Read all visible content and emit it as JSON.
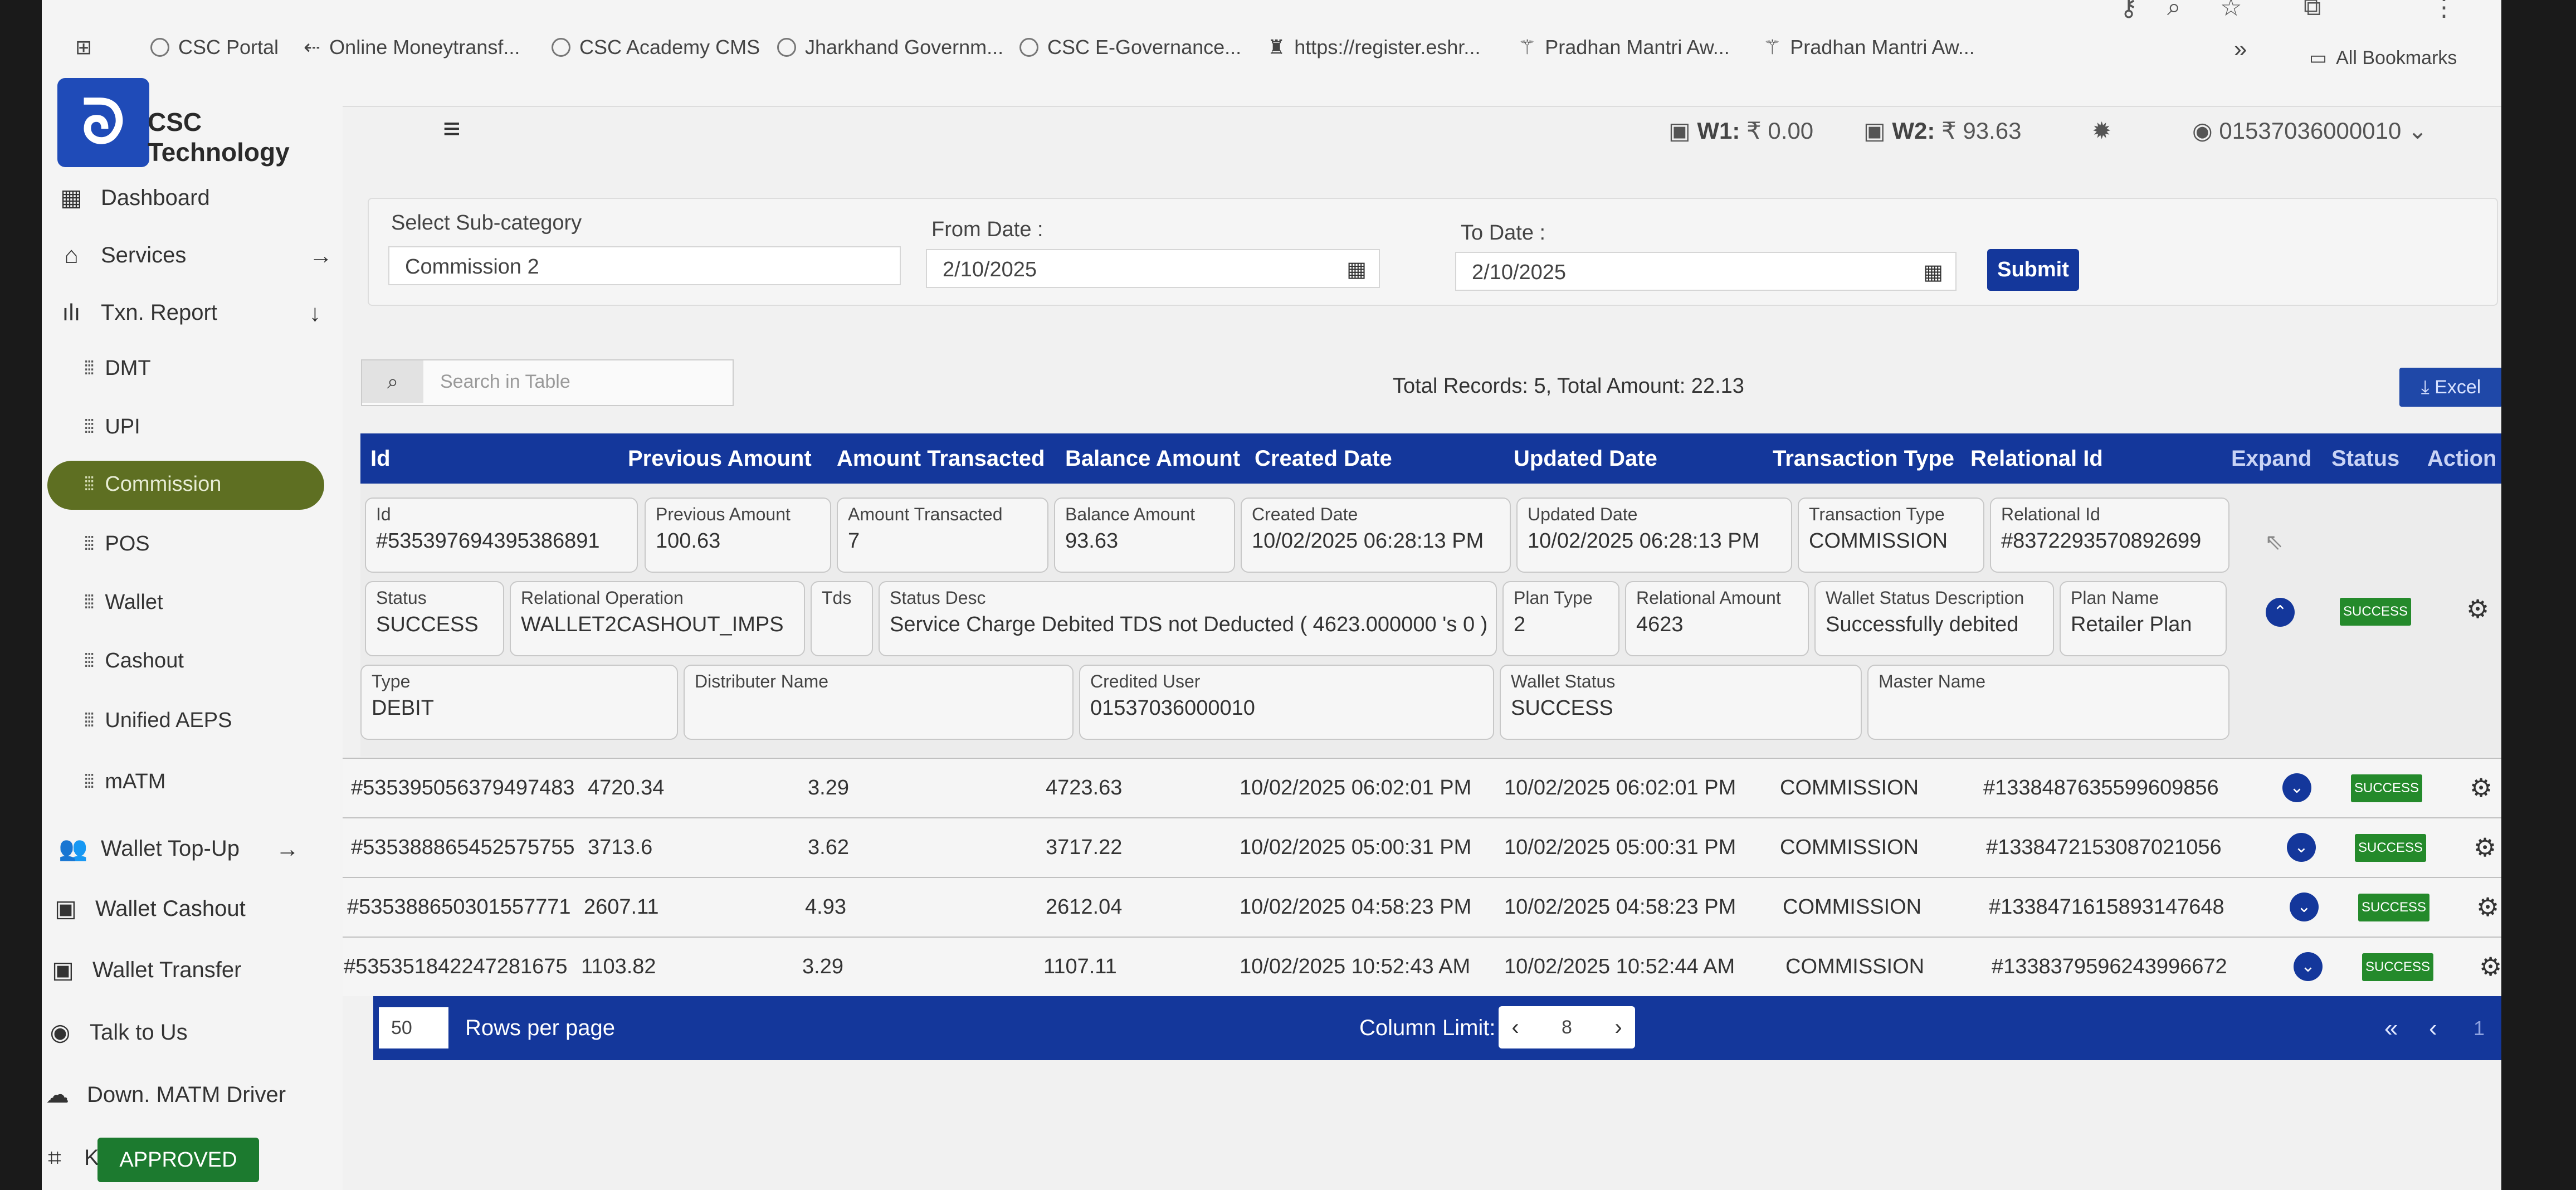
{
  "browser": {
    "bookmarks": [
      {
        "label": "CSC Portal"
      },
      {
        "label": "Online Moneytransf..."
      },
      {
        "label": "CSC Academy CMS"
      },
      {
        "label": "Jharkhand Governm..."
      },
      {
        "label": "CSC E-Governance..."
      },
      {
        "label": "https://register.eshr..."
      },
      {
        "label": "Pradhan Mantri Aw..."
      },
      {
        "label": "Pradhan Mantri Aw..."
      }
    ],
    "more": "»",
    "all_bookmarks": "All Bookmarks"
  },
  "app": {
    "brand": "CSC Technology",
    "logo_glyph": "ᘐ",
    "wallet1_label": "W1:",
    "wallet1_value": "₹ 0.00",
    "wallet2_label": "W2:",
    "wallet2_value": "₹ 93.63",
    "user_id": "01537036000010"
  },
  "sidebar": {
    "items": [
      {
        "label": "Dashboard"
      },
      {
        "label": "Services"
      },
      {
        "label": "Txn. Report"
      },
      {
        "label": "DMT"
      },
      {
        "label": "UPI"
      },
      {
        "label": "Commission"
      },
      {
        "label": "POS"
      },
      {
        "label": "Wallet"
      },
      {
        "label": "Cashout"
      },
      {
        "label": "Unified AEPS"
      },
      {
        "label": "mATM"
      },
      {
        "label": "Wallet Top-Up"
      },
      {
        "label": "Wallet Cashout"
      },
      {
        "label": "Wallet Transfer"
      },
      {
        "label": "Talk to Us"
      },
      {
        "label": "Down. MATM Driver"
      },
      {
        "label": "KYC"
      }
    ],
    "kyc_status": "APPROVED",
    "accent_color": "#5e6f22"
  },
  "filter": {
    "subcategory_label": "Select Sub-category",
    "subcategory_value": "Commission 2",
    "from_label": "From Date :",
    "from_value": "2/10/2025",
    "to_label": "To Date :",
    "to_value": "2/10/2025",
    "submit_label": "Submit"
  },
  "table_tools": {
    "search_placeholder": "Search in Table",
    "totals": "Total Records: 5,  Total Amount: 22.13",
    "excel_label": "Excel"
  },
  "table": {
    "columns": [
      "Id",
      "Previous Amount",
      "Amount Transacted",
      "Balance Amount",
      "Created Date",
      "Updated Date",
      "Transaction Type",
      "Relational Id",
      "Expand",
      "Status",
      "Action"
    ],
    "expanded_record": {
      "id_label": "Id",
      "id": "#535397694395386891",
      "prev_label": "Previous Amount",
      "prev": "100.63",
      "amt_label": "Amount Transacted",
      "amt": "7",
      "bal_label": "Balance Amount",
      "bal": "93.63",
      "created_label": "Created Date",
      "created": "10/02/2025 06:28:13 PM",
      "updated_label": "Updated Date",
      "updated": "10/02/2025 06:28:13 PM",
      "ttype_label": "Transaction Type",
      "ttype": "COMMISSION",
      "rel_label": "Relational Id",
      "rel": "#8372293570892699",
      "status_label": "Status",
      "status": "SUCCESS",
      "relop_label": "Relational Operation",
      "relop": "WALLET2CASHOUT_IMPS",
      "tds_label": "Tds",
      "tds": "",
      "desc_label": "Status Desc",
      "desc": "Service Charge Debited TDS not Deducted ( 4623.000000 's 0 )",
      "plantype_label": "Plan Type",
      "plantype": "2",
      "relamt_label": "Relational Amount",
      "relamt": "4623",
      "wsd_label": "Wallet Status Description",
      "wsd": "Successfully debited",
      "plan_label": "Plan Name",
      "plan": "Retailer Plan",
      "type_label": "Type",
      "type": "DEBIT",
      "dist_label": "Distributer Name",
      "dist": "",
      "credited_label": "Credited User",
      "credited": "01537036000010",
      "wstatus_label": "Wallet Status",
      "wstatus": "SUCCESS",
      "master_label": "Master Name",
      "master": "",
      "status_badge": "SUCCESS"
    },
    "rows": [
      {
        "id": "#535395056379497483",
        "prev": "4720.34",
        "amt": "3.29",
        "bal": "4723.63",
        "created": "10/02/2025 06:02:01 PM",
        "updated": "10/02/2025 06:02:01 PM",
        "ttype": "COMMISSION",
        "rel": "#1338487635599609856",
        "status": "SUCCESS"
      },
      {
        "id": "#535388865452575755",
        "prev": "3713.6",
        "amt": "3.62",
        "bal": "3717.22",
        "created": "10/02/2025 05:00:31 PM",
        "updated": "10/02/2025 05:00:31 PM",
        "ttype": "COMMISSION",
        "rel": "#1338472153087021056",
        "status": "SUCCESS"
      },
      {
        "id": "#535388650301557771",
        "prev": "2607.11",
        "amt": "4.93",
        "bal": "2612.04",
        "created": "10/02/2025 04:58:23 PM",
        "updated": "10/02/2025 04:58:23 PM",
        "ttype": "COMMISSION",
        "rel": "#1338471615893147648",
        "status": "SUCCESS"
      },
      {
        "id": "#535351842247281675",
        "prev": "1103.82",
        "amt": "3.29",
        "bal": "1107.11",
        "created": "10/02/2025 10:52:43 AM",
        "updated": "10/02/2025 10:52:44 AM",
        "ttype": "COMMISSION",
        "rel": "#1338379596243996672",
        "status": "SUCCESS"
      }
    ],
    "header_color": "#14379b",
    "success_color": "#248a2b"
  },
  "footer": {
    "rows_per_page_value": "50",
    "rows_per_page_label": "Rows per page",
    "column_limit_label": "Column Limit:",
    "column_limit_value": "8",
    "page": "1"
  }
}
